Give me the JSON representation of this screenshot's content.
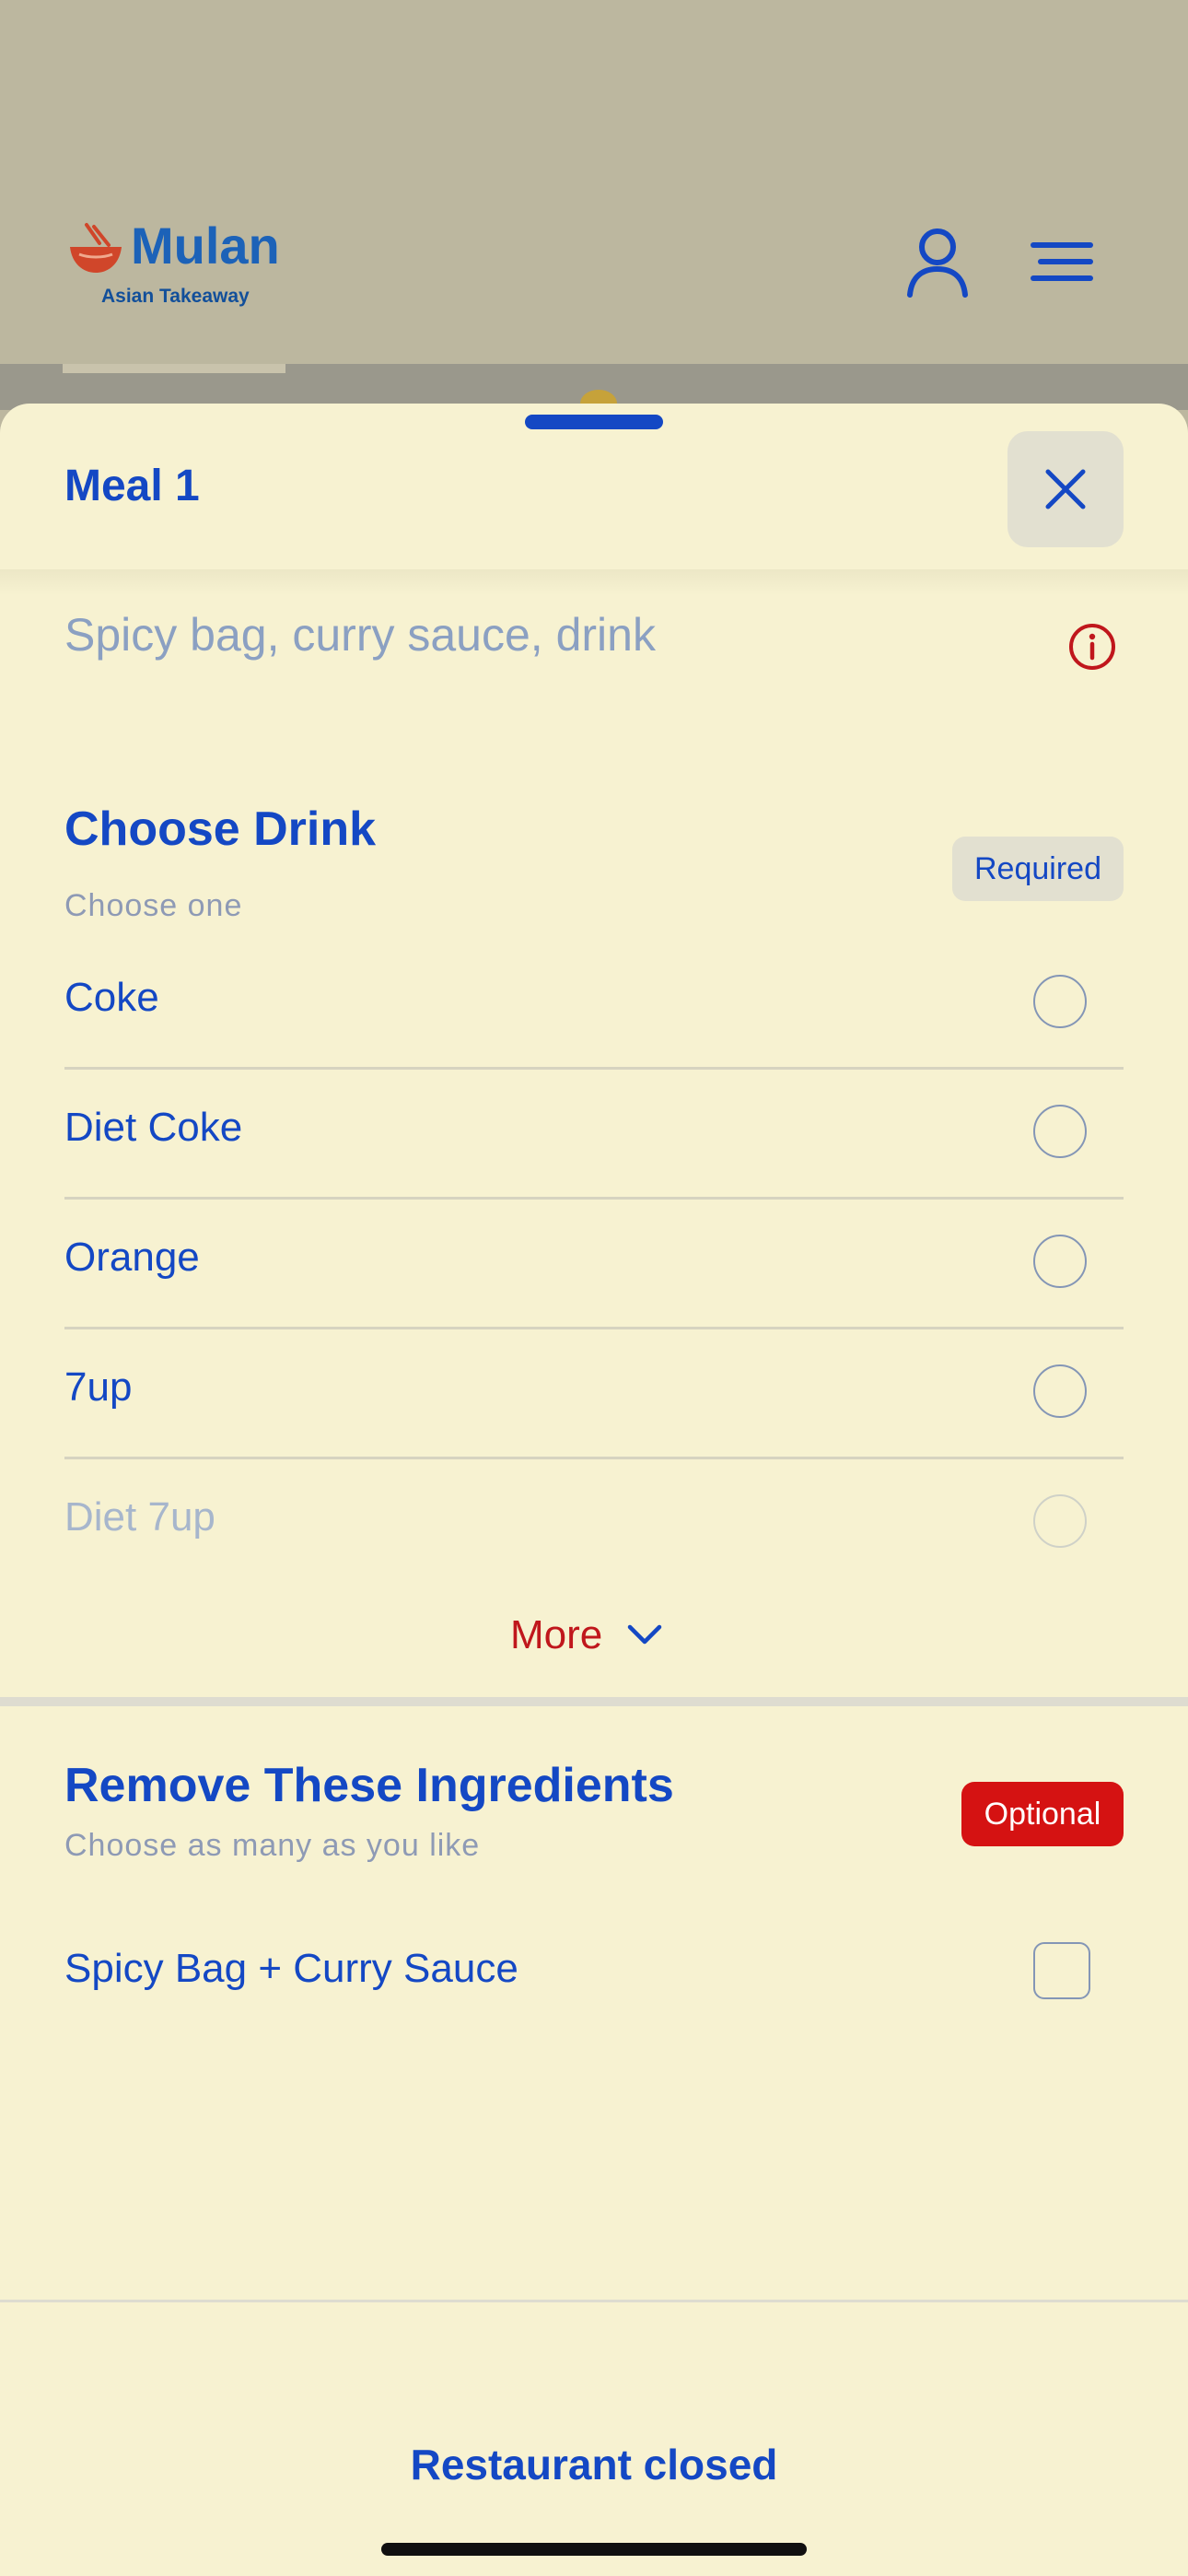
{
  "header": {
    "logo_name": "Mulan",
    "logo_subtitle": "Asian Takeaway",
    "account_icon": "person-icon",
    "menu_icon": "hamburger-menu-icon"
  },
  "sheet": {
    "title": "Meal 1",
    "close_icon": "close-icon",
    "description": "Spicy bag, curry sauce, drink",
    "info_icon": "info-icon"
  },
  "drink_section": {
    "title": "Choose Drink",
    "subtitle": "Choose one",
    "badge": "Required",
    "options": [
      {
        "label": "Coke"
      },
      {
        "label": "Diet Coke"
      },
      {
        "label": "Orange"
      },
      {
        "label": "7up"
      },
      {
        "label": "Diet 7up"
      }
    ],
    "more_label": "More"
  },
  "ingredients_section": {
    "title": "Remove These Ingredients",
    "subtitle": "Choose as many as you like",
    "badge": "Optional",
    "options": [
      {
        "label": "Spicy Bag + Curry Sauce"
      }
    ]
  },
  "footer": {
    "status": "Restaurant closed"
  },
  "colors": {
    "accent_blue": "#1448c4",
    "required_badge_bg": "#e2e0d0",
    "optional_badge_bg": "#d51212",
    "sheet_bg": "#f7f2d1",
    "more_red": "#c0171c"
  }
}
